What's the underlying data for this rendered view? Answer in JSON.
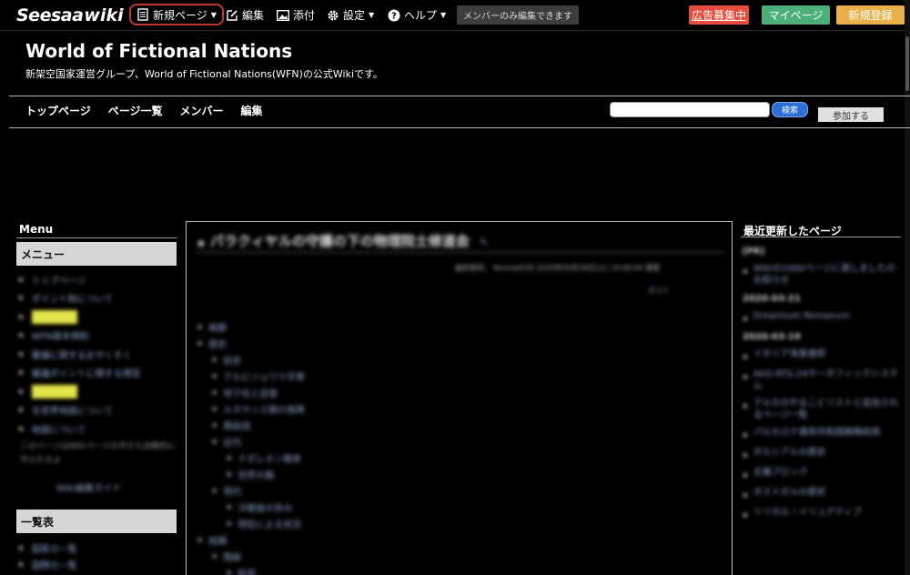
{
  "toolbar": {
    "logo_brand": "Seesaa",
    "logo_wiki": "wiki",
    "new_page": "新規ページ",
    "edit": "編集",
    "attach": "添付",
    "settings": "設定",
    "help": "ヘルプ",
    "member_badge": "メンバーのみ編集できます",
    "ad_recruit": "広告募集中",
    "my_page": "マイページ",
    "register": "新規登録"
  },
  "site": {
    "title": "World of Fictional Nations",
    "description": "新架空国家運営グループ、World of Fictional Nations(WFN)の公式Wikiです。"
  },
  "nav": {
    "items": [
      "トップページ",
      "ページ一覧",
      "メンバー",
      "編集"
    ],
    "search_button": "検索",
    "join_button": "参加する"
  },
  "left_sidebar": {
    "heading": "Menu",
    "menu_box": "メニュー",
    "menu_items": [
      {
        "label": "トップページ",
        "highlight": false
      },
      {
        "label": "ポイント制について",
        "highlight": false
      },
      {
        "label": "加盟国一覧",
        "highlight": true
      },
      {
        "label": "WFN基本規則",
        "highlight": false
      },
      {
        "label": "審議に関するおやくそく",
        "highlight": false
      },
      {
        "label": "審議ポイントに関する規定",
        "highlight": false
      },
      {
        "label": "加盟国一覧",
        "highlight": true
      },
      {
        "label": "全世界地図について",
        "highlight": false
      },
      {
        "label": "地図について",
        "highlight": false
      }
    ],
    "menu_note": "このページはWikiページの中から自動的に作られるよ",
    "guide_link": "Wiki編集ガイド",
    "list_box": "一覧表",
    "list_items": [
      "国家の一覧",
      "国際の一覧"
    ]
  },
  "main": {
    "page_title": "パラクィヤルの守護の下の物理院士修道会",
    "meta": "最終更新： Normal026 2020年05月26日(火) 19:46:04 履歴",
    "post_link": "ポスト",
    "toc": [
      {
        "level": 1,
        "label": "概要"
      },
      {
        "level": 1,
        "label": "歴史"
      },
      {
        "level": 2,
        "label": "前史"
      },
      {
        "level": 2,
        "label": "アルビジョワ十字軍"
      },
      {
        "level": 2,
        "label": "地下化と迫害"
      },
      {
        "level": 2,
        "label": "ルネサンス期の復興"
      },
      {
        "level": 2,
        "label": "再結成"
      },
      {
        "level": 2,
        "label": "近代"
      },
      {
        "level": 3,
        "label": "ナポレオン戦争"
      },
      {
        "level": 3,
        "label": "世界大戦"
      },
      {
        "level": 2,
        "label": "現代"
      },
      {
        "level": 3,
        "label": "冷戦後の歩み"
      },
      {
        "level": 3,
        "label": "現在による状況"
      },
      {
        "level": 1,
        "label": "組織"
      },
      {
        "level": 2,
        "label": "階級"
      },
      {
        "level": 3,
        "label": "総長"
      }
    ]
  },
  "right_sidebar": {
    "heading": "最近更新したページ",
    "entries": [
      {
        "type": "date",
        "text": "[PR]"
      },
      {
        "type": "item",
        "text": "Wikiの1000ページに達しましたのお知らせ"
      },
      {
        "type": "date",
        "text": "2020-03-21"
      },
      {
        "type": "item",
        "text": "Dreamium Remanum"
      },
      {
        "type": "date",
        "text": "2020-03-19"
      },
      {
        "type": "item",
        "text": "イタリア海事連邦"
      },
      {
        "type": "item",
        "text": "AKG-RTS-24サーボフィックシステム"
      },
      {
        "type": "item",
        "text": "アルカのやることリストと追加されるページ一覧"
      },
      {
        "type": "item",
        "text": "パルセロナ連邦共和国戦略総局"
      },
      {
        "type": "item",
        "text": "ボルシアルの歴史"
      },
      {
        "type": "item",
        "text": "主権ブロック"
      },
      {
        "type": "item",
        "text": "ボストボルの歴史"
      },
      {
        "type": "item",
        "text": "リリカル・イリュアティブ"
      }
    ]
  },
  "colors": {
    "background": "#000000",
    "new_page_outline": "#c0392b",
    "ad_button": "#e74c3c",
    "mypage_button": "#4caf78",
    "register_button": "#e9b04a",
    "search_button": "#2d6fd6",
    "highlight": "#e3e54b"
  },
  "icons": {
    "new_page": "document-icon",
    "edit": "edit-icon",
    "attach": "image-icon",
    "settings": "gear-icon",
    "help": "question-icon"
  }
}
